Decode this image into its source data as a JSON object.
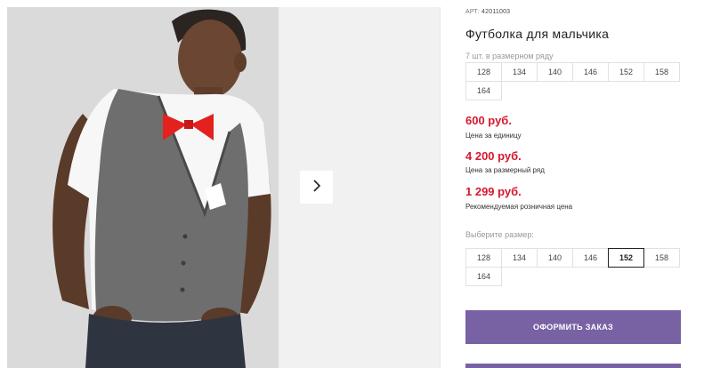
{
  "product": {
    "art_label": "АРТ:",
    "art_value": "42011003",
    "title": "Футболка для мальчика",
    "row_count": "7 шт. в размерном ряду"
  },
  "size_row": [
    "128",
    "134",
    "140",
    "146",
    "152",
    "158",
    "164"
  ],
  "prices": [
    {
      "value": "600 руб.",
      "note": "Цена за единицу"
    },
    {
      "value": "4 200 руб.",
      "note": "Цена за размерный ряд"
    },
    {
      "value": "1 299 руб.",
      "note": "Рекомендуемая розничная цена"
    }
  ],
  "size_select": {
    "label": "Выберите размер:",
    "options": [
      "128",
      "134",
      "140",
      "146",
      "152",
      "158",
      "164"
    ],
    "selected": "152"
  },
  "actions": {
    "order_label": "ОФОРМИТЬ ЗАКАЗ"
  },
  "gallery": {
    "next_icon": "chevron-right-icon"
  },
  "colors": {
    "accent": "#7862a4",
    "price": "#d4192e"
  }
}
